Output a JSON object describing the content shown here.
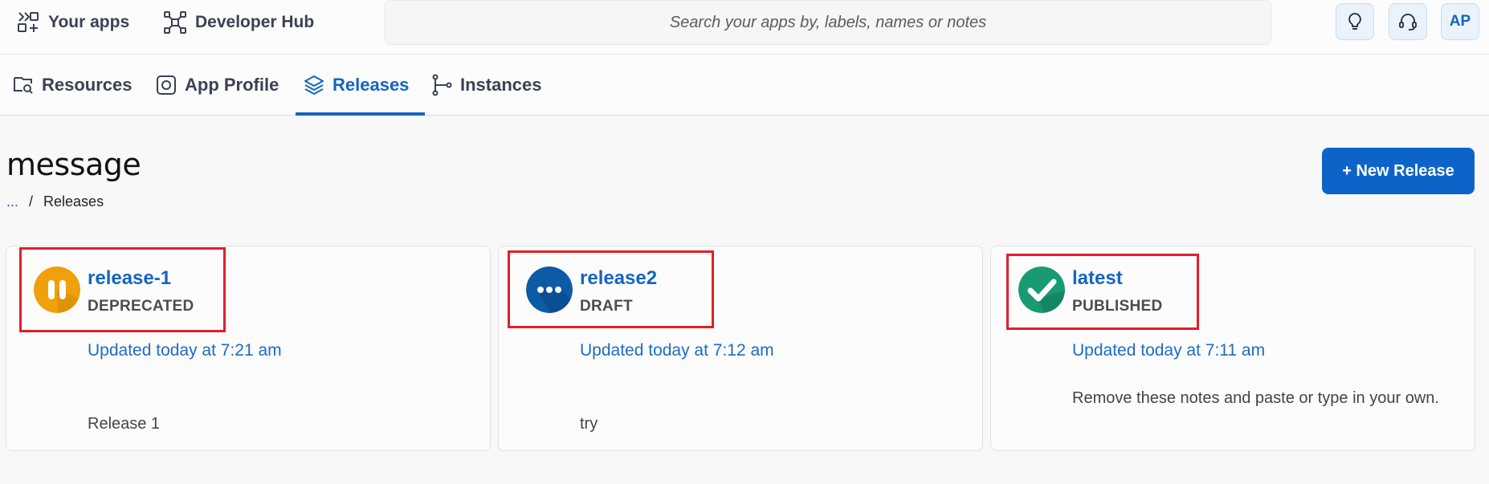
{
  "topbar": {
    "your_apps": "Your apps",
    "developer_hub": "Developer Hub",
    "search_placeholder": "Search your apps by, labels, names or notes",
    "avatar_initials": "AP"
  },
  "tabs": [
    {
      "label": "Resources",
      "icon": "resources-icon",
      "active": false
    },
    {
      "label": "App Profile",
      "icon": "app-profile-icon",
      "active": false
    },
    {
      "label": "Releases",
      "icon": "layers-icon",
      "active": true
    },
    {
      "label": "Instances",
      "icon": "branch-icon",
      "active": false
    }
  ],
  "page": {
    "title": "message",
    "breadcrumb": [
      "...",
      "/",
      "Releases"
    ],
    "new_release_label": "+ New Release"
  },
  "releases": [
    {
      "name": "release-1",
      "status": "DEPRECATED",
      "updated": "Updated today at 7:21 am",
      "notes": "Release 1",
      "icon": "pause-icon",
      "color": "#f0a00a"
    },
    {
      "name": "release2",
      "status": "DRAFT",
      "updated": "Updated today at 7:12 am",
      "notes": "try",
      "icon": "more-dots-icon",
      "color": "#0d5aa7"
    },
    {
      "name": "latest",
      "status": "PUBLISHED",
      "updated": "Updated today at 7:11 am",
      "notes": "Remove these notes and paste or type in your own.",
      "icon": "check-icon",
      "color": "#199a72"
    }
  ],
  "colors": {
    "accent": "#1565c0",
    "button": "#0d64c8",
    "highlight": "#e01f2a"
  }
}
